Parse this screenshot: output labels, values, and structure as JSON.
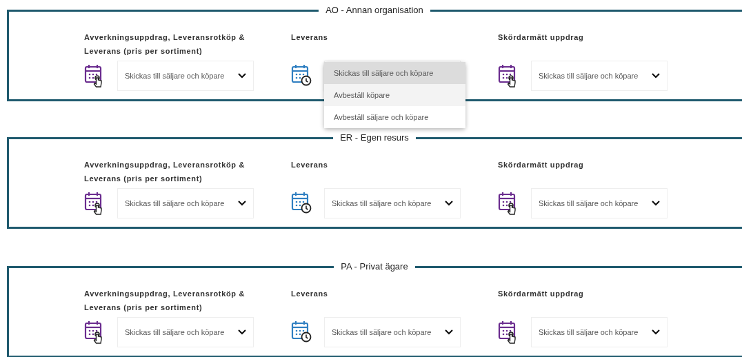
{
  "sections": [
    {
      "title": "AO - Annan organisation",
      "columns": [
        {
          "label": "Avverkningsuppdrag, Leveransrotköp & Leverans (pris per sortiment)",
          "kind": "touch",
          "select": {
            "value": "Skickas till säljare och köpare",
            "open": false
          }
        },
        {
          "label": "Leverans",
          "kind": "clock",
          "select": {
            "open": true,
            "options": [
              {
                "label": "Skickas till säljare och köpare",
                "selected": true,
                "hovered": false
              },
              {
                "label": "Avbeställ köpare",
                "selected": false,
                "hovered": true
              },
              {
                "label": "Avbeställ säljare och köpare",
                "selected": false,
                "hovered": false
              }
            ]
          }
        },
        {
          "label": "Skördarmätt uppdrag",
          "kind": "touch",
          "select": {
            "value": "Skickas till säljare och köpare",
            "open": false
          }
        }
      ]
    },
    {
      "title": "ER - Egen resurs",
      "columns": [
        {
          "label": "Avverkningsuppdrag, Leveransrotköp & Leverans (pris per sortiment)",
          "kind": "touch",
          "select": {
            "value": "Skickas till säljare och köpare",
            "open": false
          }
        },
        {
          "label": "Leverans",
          "kind": "clock",
          "select": {
            "value": "Skickas till säljare och köpare",
            "open": false
          }
        },
        {
          "label": "Skördarmätt uppdrag",
          "kind": "touch",
          "select": {
            "value": "Skickas till säljare och köpare",
            "open": false
          }
        }
      ]
    },
    {
      "title": "PA - Privat ägare",
      "columns": [
        {
          "label": "Avverkningsuppdrag, Leveransrotköp & Leverans (pris per sortiment)",
          "kind": "touch",
          "select": {
            "value": "Skickas till säljare och köpare",
            "open": false
          }
        },
        {
          "label": "Leverans",
          "kind": "clock",
          "select": {
            "value": "Skickas till säljare och köpare",
            "open": false
          }
        },
        {
          "label": "Skördarmätt uppdrag",
          "kind": "touch",
          "select": {
            "value": "Skickas till säljare och köpare",
            "open": false
          }
        }
      ]
    }
  ]
}
